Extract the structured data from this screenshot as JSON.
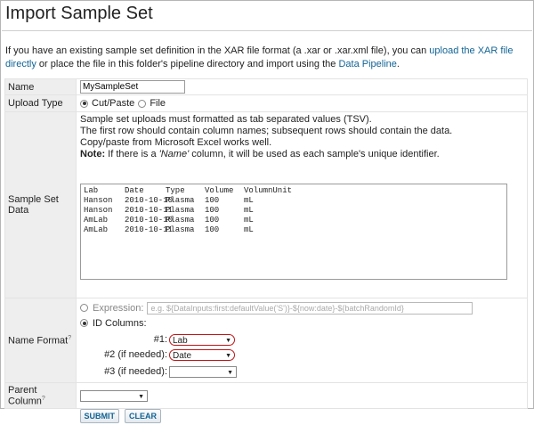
{
  "page": {
    "title": "Import Sample Set",
    "intro_before": "If you have an existing sample set definition in the XAR file format (a .xar or .xar.xml file), you can ",
    "intro_link1": "upload the XAR file directly",
    "intro_middle": " or place the file in this folder's pipeline directory and import using the ",
    "intro_link2": "Data Pipeline",
    "intro_after": "."
  },
  "form": {
    "name_label": "Name",
    "name_value": "MySampleSet",
    "upload_type_label": "Upload Type",
    "upload_options": [
      "Cut/Paste",
      "File"
    ],
    "upload_selected": "Cut/Paste",
    "data_label": "Sample Set Data",
    "help_lines": [
      "Sample set uploads must formatted as tab separated values (TSV).",
      "The first row should contain column names; subsequent rows should contain the data.",
      "Copy/paste from Microsoft Excel works well."
    ],
    "note_bold": "Note:",
    "note_before": " If there is a ",
    "note_italic": "'Name'",
    "note_after": " column, it will be used as each sample's unique identifier.",
    "tsv_header": [
      "Lab",
      "Date",
      "Type",
      "Volume",
      "VolumnUnit"
    ],
    "tsv_rows": [
      [
        "Hanson",
        "2010-10-10",
        "Plasma",
        "100",
        "mL"
      ],
      [
        "Hanson",
        "2010-10-11",
        "Plasma",
        "100",
        "mL"
      ],
      [
        "AmLab",
        "2010-10-10",
        "Plasma",
        "100",
        "mL"
      ],
      [
        "AmLab",
        "2010-10-11",
        "Plasma",
        "100",
        "mL"
      ]
    ],
    "name_format_label": "Name Format",
    "expression_label": "Expression:",
    "expression_placeholder": "e.g. ${DataInputs:first:defaultValue('S')}-${now:date}-${batchRandomId}",
    "id_columns_label": "ID Columns:",
    "id1_label": "#1:",
    "id1_value": "Lab",
    "id2_label": "#2 (if needed):",
    "id2_value": "Date",
    "id3_label": "#3 (if needed):",
    "id3_value": "",
    "parent_label": "Parent Column",
    "parent_value": "",
    "help_mark": "?",
    "submit_label": "SUBMIT",
    "clear_label": "CLEAR"
  },
  "colors": {
    "link": "#126495",
    "highlight": "#c01515",
    "label_bg": "#eeeeee"
  }
}
